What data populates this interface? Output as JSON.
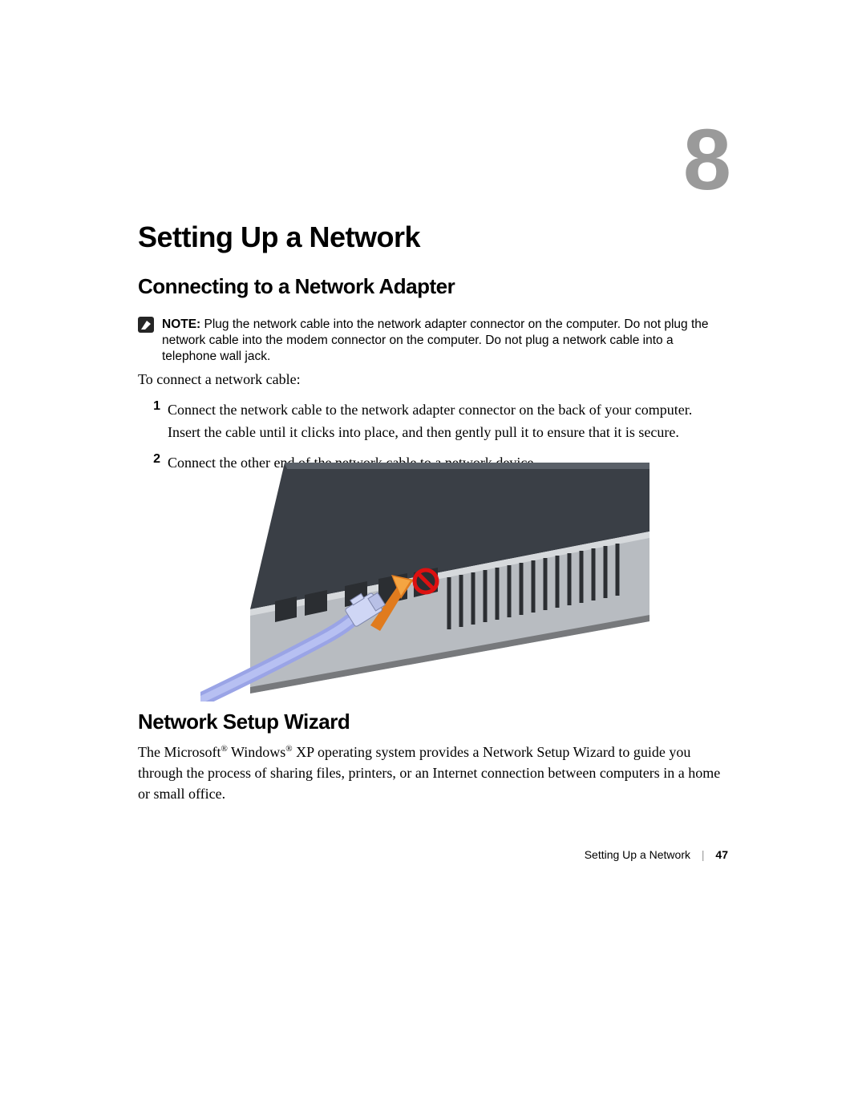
{
  "chapter": {
    "number": "8",
    "title": "Setting Up a Network"
  },
  "sections": {
    "connect": "Connecting to a Network Adapter",
    "wizard": "Network Setup Wizard"
  },
  "note": {
    "label": "NOTE:",
    "text": " Plug the network cable into the network adapter connector on the computer. Do not plug the network cable into the modem connector on the computer. Do not plug a network cable into a telephone wall jack."
  },
  "intro": "To connect a network cable:",
  "steps": [
    {
      "num": "1",
      "text": "Connect the network cable to the network adapter connector on the back of your computer. Insert the cable until it clicks into place, and then gently pull it to ensure that it is secure."
    },
    {
      "num": "2",
      "text": "Connect the other end of the network cable to a network device."
    }
  ],
  "wizard_para_parts": {
    "p1": "The Microsoft",
    "reg1": "®",
    "p2": " Windows",
    "reg2": "®",
    "p3": " XP operating system provides a Network Setup Wizard to guide you through the process of sharing files, printers, or an Internet connection between computers in a home or small office."
  },
  "footer": {
    "title": "Setting Up a Network",
    "page": "47"
  },
  "figure_alt": "Illustration of a laptop back panel with a blue Ethernet cable being plugged into the network adapter port; an orange arrow points to the correct port and a red prohibition symbol marks the adjacent modem port."
}
